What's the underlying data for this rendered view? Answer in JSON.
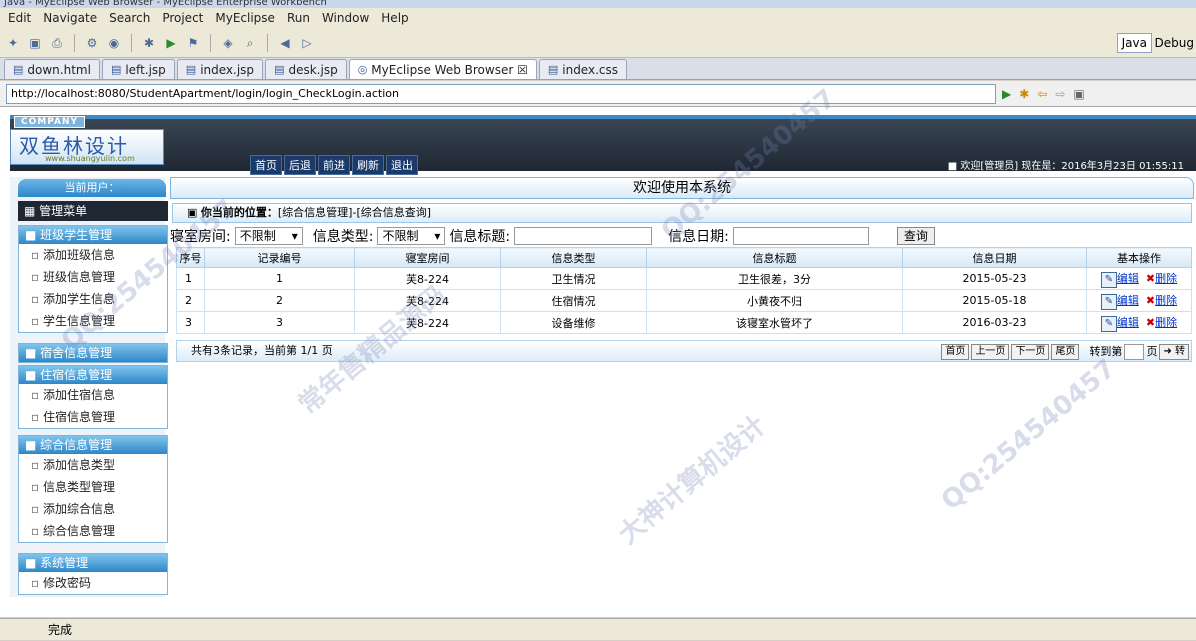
{
  "window_title": "Java - MyEclipse Web Browser - MyEclipse Enterprise Workbench",
  "menu": [
    "Edit",
    "Navigate",
    "Search",
    "Project",
    "MyEclipse",
    "Run",
    "Window",
    "Help"
  ],
  "perspectives": [
    "Java",
    "Debug"
  ],
  "tabs": [
    {
      "label": "down.html",
      "active": false
    },
    {
      "label": "left.jsp",
      "active": false
    },
    {
      "label": "index.jsp",
      "active": false
    },
    {
      "label": "desk.jsp",
      "active": false
    },
    {
      "label": "MyEclipse Web Browser ☒",
      "active": true
    },
    {
      "label": "index.css",
      "active": false
    }
  ],
  "url": "http://localhost:8080/StudentApartment/login/login_CheckLogin.action",
  "header": {
    "company": "COMPANY",
    "logo_text": "双鱼林设计",
    "logo_sub": "www.shuangyulin.com",
    "nav": [
      "首页",
      "后退",
      "前进",
      "刷新",
      "退出"
    ],
    "welcome": "■ 欢迎[管理员]  现在是：2016年3月23日 01:55:11"
  },
  "sidebar": {
    "current_user": "当前用户：",
    "menu_title": "管理菜单",
    "groups": [
      {
        "title": "班级学生管理",
        "items": [
          "添加班级信息",
          "班级信息管理",
          "添加学生信息",
          "学生信息管理"
        ]
      },
      {
        "title": "宿舍信息管理",
        "items": []
      },
      {
        "title": "住宿信息管理",
        "items": [
          "添加住宿信息",
          "住宿信息管理"
        ]
      },
      {
        "title": "综合信息管理",
        "items": [
          "添加信息类型",
          "信息类型管理",
          "添加综合信息",
          "综合信息管理"
        ]
      },
      {
        "title": "系统管理",
        "items": [
          "修改密码"
        ]
      }
    ]
  },
  "main": {
    "welcome": "欢迎使用本系统",
    "position_label": "你当前的位置：",
    "position_path": "[综合信息管理]-[综合信息查询]",
    "filter": {
      "room_label": "寝室房间:",
      "room_value": "不限制",
      "type_label": "信息类型:",
      "type_value": "不限制",
      "title_label": "信息标题:",
      "date_label": "信息日期:",
      "query_button": "查询"
    },
    "columns": [
      "序号",
      "记录编号",
      "寝室房间",
      "信息类型",
      "信息标题",
      "信息日期",
      "基本操作"
    ],
    "rows": [
      {
        "no": "1",
        "id": "1",
        "room": "芙8-224",
        "type": "卫生情况",
        "title": "卫生很差，3分",
        "date": "2015-05-23"
      },
      {
        "no": "2",
        "id": "2",
        "room": "芙8-224",
        "type": "住宿情况",
        "title": "小黄夜不归",
        "date": "2015-05-18"
      },
      {
        "no": "3",
        "id": "3",
        "room": "芙8-224",
        "type": "设备维修",
        "title": "该寝室水管坏了",
        "date": "2016-03-23"
      }
    ],
    "edit_label": "编辑",
    "delete_label": "删除",
    "pager": {
      "summary": "共有3条记录，当前第 1/1 页",
      "first": "首页",
      "prev": "上一页",
      "next": "下一页",
      "last": "尾页",
      "goto_label": "转到第",
      "page_unit": "页",
      "go": "转"
    }
  },
  "status": "完成",
  "watermarks": [
    "QQ:254540457",
    "大神计算机设计",
    "常年售精品源码"
  ]
}
